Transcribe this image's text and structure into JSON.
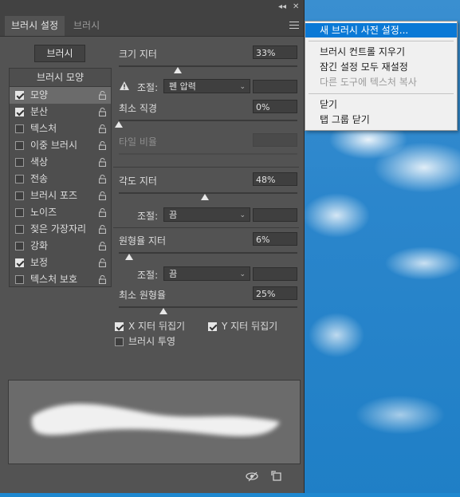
{
  "window": {
    "collapse_icon": "double-chevron-left",
    "close_icon": "close"
  },
  "tabs": [
    {
      "label": "브러시 설정",
      "active": true
    },
    {
      "label": "브러시",
      "active": false
    }
  ],
  "brush_button_label": "브러시",
  "brush_tip_list": {
    "header": "브러시 모양",
    "items": [
      {
        "label": "모양",
        "checked": true,
        "selected": true
      },
      {
        "label": "분산",
        "checked": true,
        "selected": false
      },
      {
        "label": "텍스처",
        "checked": false,
        "selected": false
      },
      {
        "label": "이중 브러시",
        "checked": false,
        "selected": false
      },
      {
        "label": "색상",
        "checked": false,
        "selected": false
      },
      {
        "label": "전송",
        "checked": false,
        "selected": false
      },
      {
        "label": "브러시 포즈",
        "checked": false,
        "selected": false
      },
      {
        "label": "노이즈",
        "checked": false,
        "selected": false
      },
      {
        "label": "젖은 가장자리",
        "checked": false,
        "selected": false
      },
      {
        "label": "강화",
        "checked": false,
        "selected": false
      },
      {
        "label": "보정",
        "checked": true,
        "selected": false
      },
      {
        "label": "텍스처 보호",
        "checked": false,
        "selected": false
      }
    ]
  },
  "size_jitter": {
    "label": "크기 지터",
    "value": "33%",
    "level": 0.33
  },
  "size_control": {
    "label": "조절:",
    "value": "펜 압력"
  },
  "min_diameter": {
    "label": "최소 직경",
    "value": "0%",
    "level": 0
  },
  "tilt_scale": {
    "label": "타일 비율",
    "value": ""
  },
  "angle_jitter": {
    "label": "각도 지터",
    "value": "48%",
    "level": 0.48
  },
  "angle_control": {
    "label": "조절:",
    "value": "끔"
  },
  "roundness_jitter": {
    "label": "원형율 지터",
    "value": "6%",
    "level": 0.06
  },
  "roundness_control": {
    "label": "조절:",
    "value": "끔"
  },
  "min_roundness": {
    "label": "최소 원형율",
    "value": "25%",
    "level": 0.25
  },
  "flip_x": {
    "label": "X 지터 뒤집기",
    "checked": true
  },
  "flip_y": {
    "label": "Y 지터 뒤집기",
    "checked": true
  },
  "brush_projection": {
    "label": "브러시 투영",
    "checked": false
  },
  "context_menu": {
    "items": [
      {
        "label": "새 브러시 사전 설정...",
        "highlighted": true,
        "disabled": false
      },
      {
        "label": "브러시 컨트롤 지우기",
        "highlighted": false,
        "disabled": false
      },
      {
        "label": "잠긴 설정 모두 재설정",
        "highlighted": false,
        "disabled": false
      },
      {
        "label": "다른 도구에 텍스처 복사",
        "highlighted": false,
        "disabled": true
      },
      {
        "label": "닫기",
        "highlighted": false,
        "disabled": false
      },
      {
        "label": "탭 그룹 닫기",
        "highlighted": false,
        "disabled": false
      }
    ]
  },
  "colors": {
    "panel": "#535353",
    "menu_highlight": "#0a79d6",
    "sky": "#2b86cc"
  }
}
